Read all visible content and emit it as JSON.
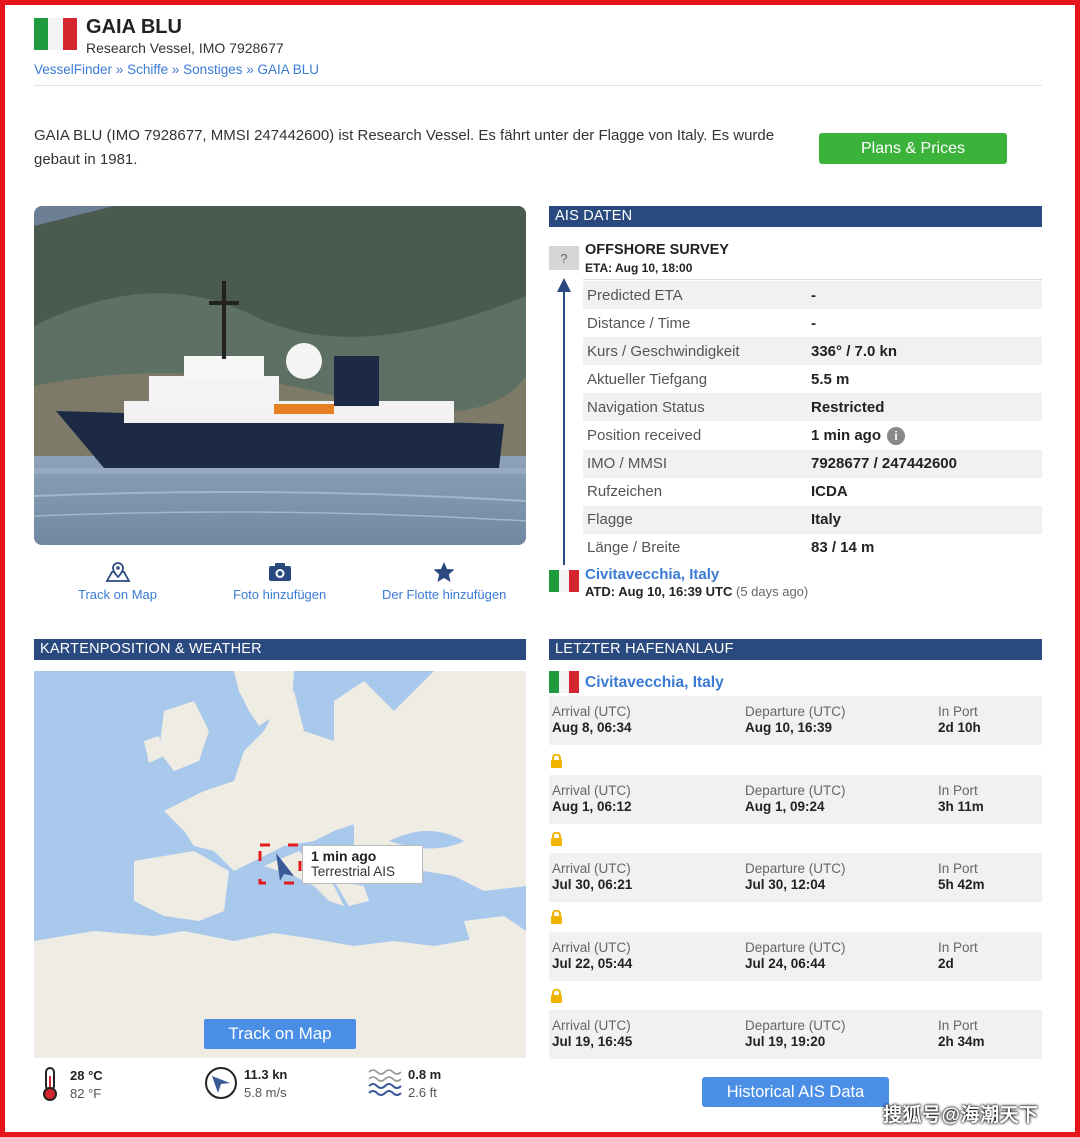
{
  "vessel": {
    "name": "GAIA BLU",
    "subtitle": "Research Vessel, IMO 7928677",
    "description": "GAIA BLU (IMO 7928677, MMSI 247442600) ist Research Vessel. Es fährt unter der Flagge von Italy. Es wurde gebaut in 1981."
  },
  "breadcrumb": [
    "VesselFinder",
    "Schiffe",
    "Sonstiges",
    "GAIA BLU"
  ],
  "breadcrumb_sep": "»",
  "plans_button": "Plans & Prices",
  "actions": {
    "track": "Track on Map",
    "photo": "Foto hinzufügen",
    "fleet": "Der Flotte hinzufügen"
  },
  "ais": {
    "header": "AIS DATEN",
    "unknown_flag": "?",
    "destination": "OFFSHORE SURVEY",
    "eta": "ETA: Aug 10, 18:00",
    "rows": [
      {
        "k": "Predicted ETA",
        "v": "-"
      },
      {
        "k": "Distance / Time",
        "v": "-"
      },
      {
        "k": "Kurs / Geschwindigkeit",
        "v": "336° / 7.0 kn"
      },
      {
        "k": "Aktueller Tiefgang",
        "v": "5.5 m"
      },
      {
        "k": "Navigation Status",
        "v": "Restricted"
      },
      {
        "k": "Position received",
        "v": "1 min ago"
      },
      {
        "k": "IMO / MMSI",
        "v": "7928677 / 247442600"
      },
      {
        "k": "Rufzeichen",
        "v": "ICDA"
      },
      {
        "k": "Flagge",
        "v": "Italy"
      },
      {
        "k": "Länge / Breite",
        "v": "83 / 14 m"
      }
    ],
    "origin": "Civitavecchia, Italy",
    "atd": "ATD: Aug 10, 16:39 UTC",
    "atd_ago": "(5 days ago)"
  },
  "map": {
    "header": "KARTENPOSITION & WEATHER",
    "tooltip_time": "1 min ago",
    "tooltip_source": "Terrestrial AIS",
    "button": "Track on Map",
    "weather": {
      "temp_c": "28 °C",
      "temp_f": "82 °F",
      "wind_kn": "11.3 kn",
      "wind_ms": "5.8 m/s",
      "wave_m": "0.8 m",
      "wave_ft": "2.6 ft"
    }
  },
  "port_calls": {
    "header": "LETZTER HAFENANLAUF",
    "port": "Civitavecchia, Italy",
    "labels": {
      "arrival": "Arrival (UTC)",
      "departure": "Departure (UTC)",
      "in_port": "In Port"
    },
    "calls": [
      {
        "arrival": "Aug 8, 06:34",
        "departure": "Aug 10, 16:39",
        "in_port": "2d 10h"
      },
      {
        "arrival": "Aug 1, 06:12",
        "departure": "Aug 1, 09:24",
        "in_port": "3h 11m"
      },
      {
        "arrival": "Jul 30, 06:21",
        "departure": "Jul 30, 12:04",
        "in_port": "5h 42m"
      },
      {
        "arrival": "Jul 22, 05:44",
        "departure": "Jul 24, 06:44",
        "in_port": "2d"
      },
      {
        "arrival": "Jul 19, 16:45",
        "departure": "Jul 19, 19:20",
        "in_port": "2h 34m"
      }
    ],
    "history_button": "Historical AIS Data"
  },
  "watermark": "搜狐号@海潮天下",
  "colors": {
    "frame": "#e8141b",
    "section": "#2a4a7f",
    "link": "#3a7bd5",
    "green_button": "#3bb33b",
    "blue_button": "#4a8ee6"
  }
}
